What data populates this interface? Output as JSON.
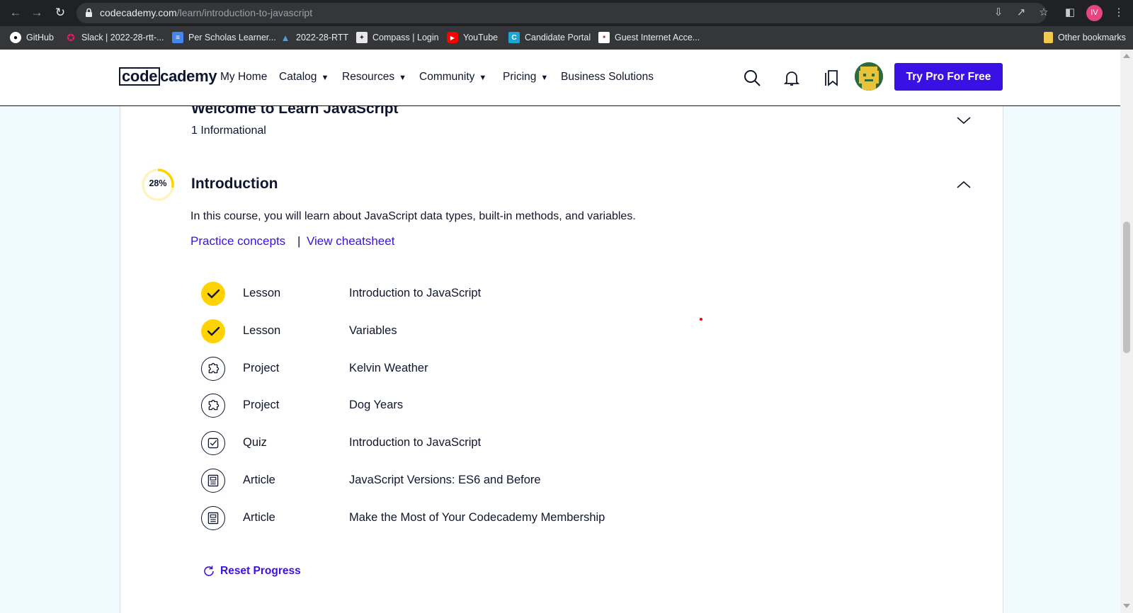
{
  "browser": {
    "url_domain": "codecademy.com",
    "url_path": "/learn/introduction-to-javascript",
    "profile_initials": "IV",
    "bookmarks": [
      {
        "label": "GitHub",
        "icon": "github-icon",
        "color": "#ffffff"
      },
      {
        "label": "Slack | 2022-28-rtt-...",
        "icon": "slack-icon",
        "color": "#e01e5a"
      },
      {
        "label": "Per Scholas Learner...",
        "icon": "docs-icon",
        "color": "#4285f4"
      },
      {
        "label": "2022-28-RTT",
        "icon": "graduation-cap-icon",
        "color": "#4aa3df"
      },
      {
        "label": "Compass | Login",
        "icon": "compass-icon",
        "color": "#e8e8e8"
      },
      {
        "label": "YouTube",
        "icon": "youtube-icon",
        "color": "#ff0000"
      },
      {
        "label": "Candidate Portal",
        "icon": "candidate-portal-icon",
        "color": "#1ba6d6"
      },
      {
        "label": "Guest Internet Acce...",
        "icon": "guest-internet-icon",
        "color": "#ffffff"
      }
    ],
    "other_bookmarks": "Other bookmarks"
  },
  "header": {
    "logo_boxed": "code",
    "logo_rest": "cademy",
    "nav": {
      "my_home": "My Home",
      "catalog": "Catalog",
      "resources": "Resources",
      "community": "Community",
      "pricing": "Pricing",
      "business": "Business Solutions"
    },
    "cta": "Try Pro For Free"
  },
  "previous_section": {
    "title": "Welcome to Learn JavaScript",
    "subtitle": "1 Informational"
  },
  "section": {
    "progress_label": "28%",
    "progress_fraction": 0.28,
    "title": "Introduction",
    "description": "In this course, you will learn about JavaScript data types, built-in methods, and variables.",
    "practice_link": "Practice concepts",
    "separator": "|",
    "cheatsheet_link": "View cheatsheet",
    "items": [
      {
        "type": "Lesson",
        "title": "Introduction to JavaScript",
        "status": "completed",
        "icon": "check-icon"
      },
      {
        "type": "Lesson",
        "title": "Variables",
        "status": "completed",
        "icon": "check-icon"
      },
      {
        "type": "Project",
        "title": "Kelvin Weather",
        "status": "not-started",
        "icon": "puzzle-icon"
      },
      {
        "type": "Project",
        "title": "Dog Years",
        "status": "not-started",
        "icon": "puzzle-icon"
      },
      {
        "type": "Quiz",
        "title": "Introduction to JavaScript",
        "status": "not-started",
        "icon": "quiz-icon"
      },
      {
        "type": "Article",
        "title": "JavaScript Versions: ES6 and Before",
        "status": "not-started",
        "icon": "article-icon"
      },
      {
        "type": "Article",
        "title": "Make the Most of Your Codecademy Membership",
        "status": "not-started",
        "icon": "article-icon"
      }
    ],
    "reset_label": "Reset Progress"
  },
  "colors": {
    "brand_blue": "#3a10e5",
    "navy": "#10162f",
    "complete_yellow": "#ffd300",
    "page_bg": "#f0fbff"
  }
}
